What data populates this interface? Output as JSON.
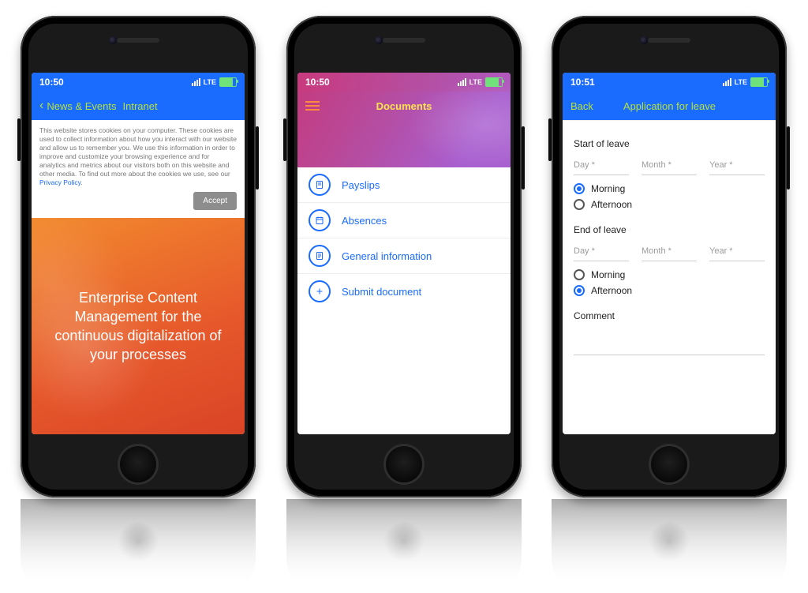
{
  "phone1": {
    "status": {
      "time": "10:50",
      "net": "LTE"
    },
    "nav": {
      "back": "News & Events",
      "title": "Intranet"
    },
    "cookie": {
      "text": "This website stores cookies on your computer. These cookies are used to collect information about how you interact with our website and allow us to remember you. We use this information in order to improve and customize your browsing experience and for analytics and metrics about our visitors both on this website and other media. To find out more about the cookies we use, see our ",
      "link": "Privacy Policy",
      "accept": "Accept"
    },
    "hero": "Enterprise Content Management for the continuous digitalization of your processes"
  },
  "phone2": {
    "status": {
      "time": "10:50",
      "net": "LTE"
    },
    "nav": {
      "title": "Documents"
    },
    "items": [
      {
        "label": "Payslips"
      },
      {
        "label": "Absences"
      },
      {
        "label": "General information"
      },
      {
        "label": "Submit document"
      }
    ]
  },
  "phone3": {
    "status": {
      "time": "10:51",
      "net": "LTE"
    },
    "nav": {
      "back": "Back",
      "title": "Application for leave"
    },
    "form": {
      "start_section": "Start of leave",
      "end_section": "End of leave",
      "day": "Day *",
      "month": "Month *",
      "year": "Year *",
      "morning": "Morning",
      "afternoon": "Afternoon",
      "comment": "Comment"
    }
  }
}
